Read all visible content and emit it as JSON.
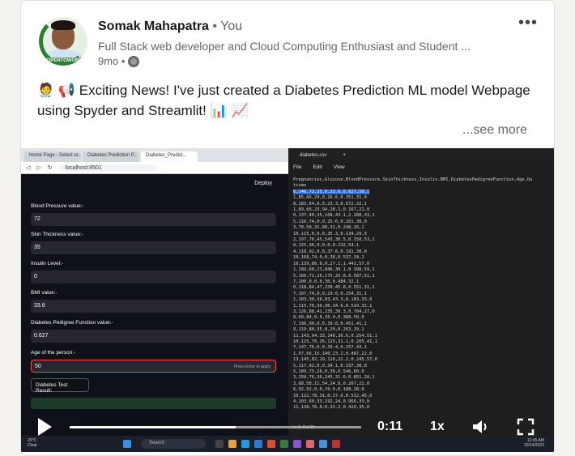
{
  "post": {
    "author_name": "Somak Mahapatra",
    "author_relation": "• You",
    "headline": "Full Stack web developer and Cloud Computing Enthusiast and Student ...",
    "time_ago": "9mo •",
    "avatar_label": "#OPENTOWORK",
    "body": "🧑‍⚕️ 📢  Exciting News! I've just created a Diabetes Prediction ML model Webpage using Spyder and Streamlit! 📊 📈",
    "see_more": "...see more"
  },
  "browser": {
    "tabs": [
      "Home Page - Select or...",
      "Diabetes Prediction P...",
      "Diabetes_Predict..."
    ],
    "url": "localhost:8501",
    "deploy": "Deploy",
    "fields": [
      {
        "label": "Blood Pressure value:-",
        "value": "72"
      },
      {
        "label": "Skin Thickness value:-",
        "value": "35"
      },
      {
        "label": "Insulin Level:-",
        "value": "0"
      },
      {
        "label": "BMI value:-",
        "value": "33.6"
      },
      {
        "label": "Diabetes Pedigree Function value:-",
        "value": "0.627"
      },
      {
        "label": "Age of the person:-",
        "value": "50"
      }
    ],
    "input_hint": "Press Enter to apply",
    "button": "Diabetes Test Result:"
  },
  "notepad": {
    "tab": "diabetes.csv",
    "menu": [
      "File",
      "Edit",
      "View"
    ],
    "header": "Pregnancies,Glucose,BloodPressure,SkinThickness,Insulin,BMI,DiabetesPedigreeFunction,Age,Ou\ntcome",
    "selected_line": "6,148,72,35,0,33.6,0.627,50,1",
    "lines": [
      "1,85,66,29,0,26.6,0.351,31,0",
      "8,183,64,0,0,23.3,0.672,32,1",
      "1,89,66,23,94,28.1,0.167,21,0",
      "0,137,40,35,168,43.1,2.288,33,1",
      "5,116,74,0,0,25.6,0.201,30,0",
      "3,78,50,32,88,31,0.248,26,1",
      "10,115,0,0,0,35.3,0.134,29,0",
      "2,197,70,45,543,30.5,0.158,53,1",
      "8,125,96,0,0,0,0.232,54,1",
      "4,110,92,0,0,37.6,0.191,30,0",
      "10,168,74,0,0,38,0.537,34,1",
      "10,139,80,0,0,27.1,1.441,57,0",
      "1,189,60,23,846,30.1,0.398,59,1",
      "5,166,72,19,175,25.8,0.587,51,1",
      "7,100,0,0,0,30,0.484,32,1",
      "0,118,84,47,230,45.8,0.551,31,1",
      "7,107,74,0,0,29.6,0.254,31,1",
      "1,103,30,38,83,43.3,0.183,33,0",
      "1,115,70,30,96,34.6,0.529,32,1",
      "3,126,88,41,235,39.3,0.704,27,0",
      "8,99,84,0,0,35.4,0.388,50,0",
      "7,196,90,0,0,39.8,0.451,41,1",
      "9,119,80,35,0,29,0.263,29,1",
      "11,143,94,33,146,36.6,0.254,51,1",
      "10,125,70,26,115,31.1,0.205,41,1",
      "7,147,76,0,0,39.4,0.257,43,1",
      "1,97,66,15,140,23.2,0.487,22,0",
      "13,145,82,19,110,22.2,0.245,57,0",
      "5,117,92,0,0,34.1,0.337,38,0",
      "5,109,75,26,0,36,0.546,60,0",
      "3,158,76,36,245,31.6,0.851,28,1",
      "3,88,58,11,54,24.8,0.267,22,0",
      "6,92,92,0,0,19.9,0.188,28,0",
      "10,122,78,31,0,27.6,0.512,45,0",
      "4,103,60,33,192,24,0.966,33,0",
      "11,138,76,0,0,33.2,0.420,35,0"
    ]
  },
  "controls": {
    "time": "0:11",
    "speed": "1x",
    "progress_fraction": 0.57
  },
  "taskbar": {
    "weather": "26°C\nClear",
    "search": "Search",
    "clock": "12:45 AM\n10/14/2023",
    "status_text": "Ln 2, Col 30"
  }
}
